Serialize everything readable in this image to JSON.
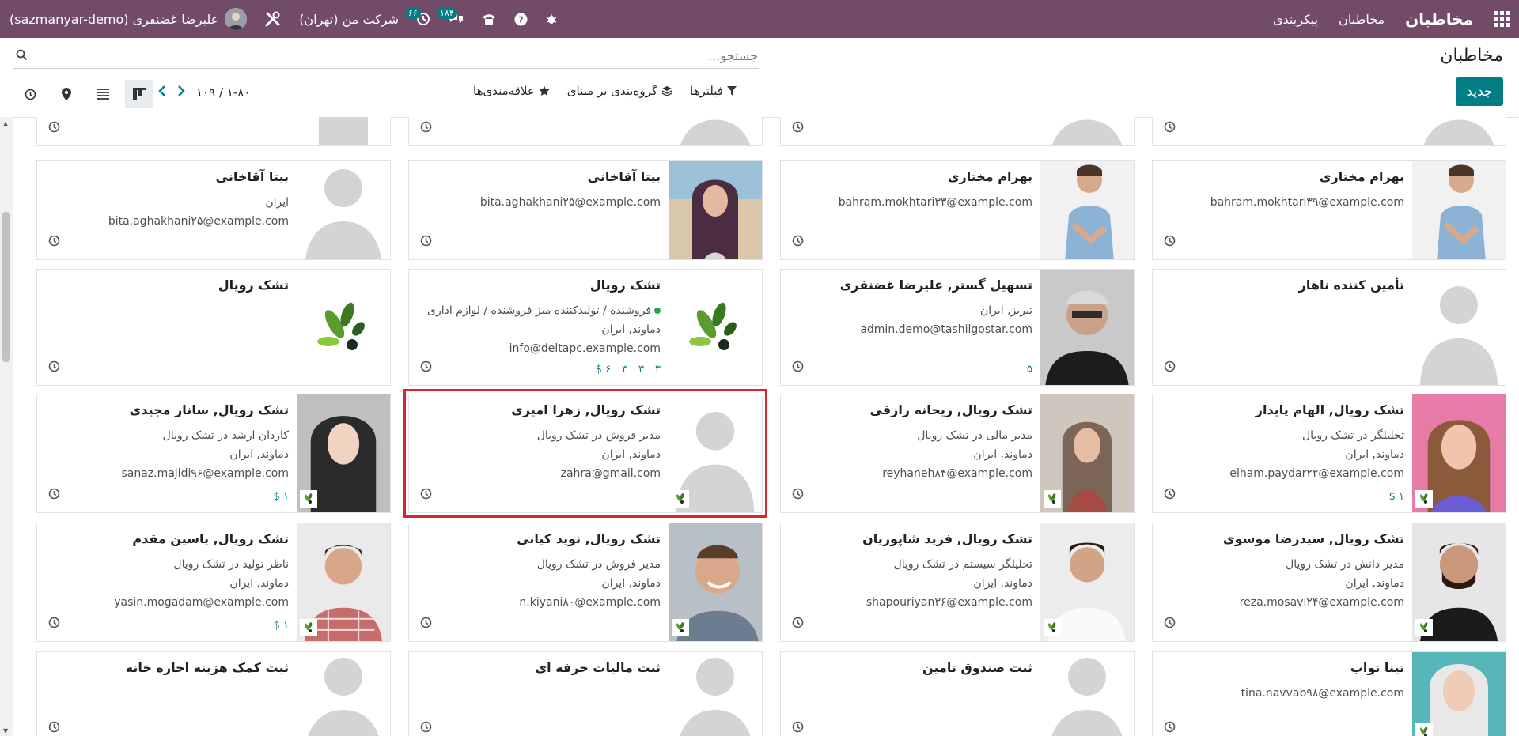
{
  "topbar": {
    "brand": "مخاطبان",
    "menu": [
      "مخاطبان",
      "پیکربندی"
    ],
    "company": "شرکت من (تهران)",
    "activity_badge": "۶۶",
    "chat_badge": "۱۸۴",
    "user": "علیرضا غضنفری (sazmanyar-demo)"
  },
  "control": {
    "title": "مخاطبان",
    "new_label": "جدید",
    "search_placeholder": "جستجو...",
    "filters_label": "فیلترها",
    "groupby_label": "گروه‌بندی بر مبنای",
    "favorites_label": "علاقه‌مندی‌ها",
    "pager_range": "۱-۸۰",
    "pager_total": "۱۰۹",
    "pager_sep": "/"
  },
  "colors": {
    "topbar": "#714b67",
    "accent": "#017e84",
    "selection": "#d9232d"
  },
  "cards": [
    {
      "name": "",
      "l1": "",
      "l2": "",
      "l3": "",
      "img": "placeholder",
      "stats": []
    },
    {
      "name": "",
      "l1": "",
      "l2": "",
      "l3": "",
      "img": "placeholder",
      "stats": []
    },
    {
      "name": "",
      "l1": "",
      "l2": "",
      "l3": "",
      "img": "placeholder",
      "stats": []
    },
    {
      "name": "",
      "l1": "",
      "l2": "",
      "l3": "",
      "img": "building",
      "stats": []
    },
    {
      "name": "بهرام مختاری",
      "l1": "bahram.mokhtari۳۹@example.com",
      "l2": "",
      "l3": "",
      "img": "man-blue",
      "stats": []
    },
    {
      "name": "بهرام مختاری",
      "l1": "bahram.mokhtari۳۳@example.com",
      "l2": "",
      "l3": "",
      "img": "man-blue",
      "stats": []
    },
    {
      "name": "بیتا آقاخانی",
      "l1": "bita.aghakhani۲۵@example.com",
      "l2": "",
      "l3": "",
      "img": "woman-scarf",
      "stats": []
    },
    {
      "name": "بیتا آقاخانی",
      "l1": "ایران",
      "l2": "bita.aghakhani۲۵@example.com",
      "l3": "",
      "img": "placeholder",
      "stats": []
    },
    {
      "name": "تأمین کننده ناهار",
      "l1": "",
      "l2": "",
      "l3": "",
      "img": "placeholder",
      "stats": []
    },
    {
      "name": "تسهیل گستر, علیرضا غضنفری",
      "l1": "تبریز, ایران",
      "l2": "admin.demo@tashilgostar.com",
      "l3": "",
      "img": "man-grey",
      "stats": [
        "۵"
      ]
    },
    {
      "name": "تشک رویال",
      "l1": "فروشنده / تولیدکننده میز  فروشنده / لوازم اداری",
      "l2": "دماوند, ایران",
      "l3": "info@deltapc.example.com",
      "img": "logo",
      "stats": [
        "۳",
        "۳",
        "۳",
        "۶ $"
      ]
    },
    {
      "name": "تشک رویال",
      "l1": "",
      "l2": "",
      "l3": "",
      "img": "logo",
      "stats": []
    },
    {
      "name": "تشک رویال, الهام پایدار",
      "l1": "تحلیلگر در تشک رویال",
      "l2": "دماوند, ایران",
      "l3": "elham.paydar۲۲@example.com",
      "img": "woman-pink",
      "stats": [
        "۱ $"
      ]
    },
    {
      "name": "تشک رویال, ریحانه رازقی",
      "l1": "مدیر مالی در تشک رویال",
      "l2": "دماوند, ایران",
      "l3": "reyhaneh۸۴@example.com",
      "img": "woman-scarf2",
      "stats": []
    },
    {
      "name": "تشک رویال, زهرا امیری",
      "l1": "مدیر فروش در تشک رویال",
      "l2": "دماوند, ایران",
      "l3": "zahra@gmail.com",
      "img": "placeholder",
      "stats": []
    },
    {
      "name": "تشک رویال, ساناز مجیدی",
      "l1": "کاردان ارشد در تشک رویال",
      "l2": "دماوند, ایران",
      "l3": "sanaz.majidi۹۶@example.com",
      "img": "woman-hijab",
      "stats": [
        "۱ $"
      ]
    },
    {
      "name": "تشک رویال, سیدرضا موسوی",
      "l1": "مدیر دانش در تشک رویال",
      "l2": "دماوند, ایران",
      "l3": "reza.mosavi۲۴@example.com",
      "img": "man-beard",
      "stats": []
    },
    {
      "name": "تشک رویال, فرید شاپوریان",
      "l1": "تحلیلگر سیستم در تشک رویال",
      "l2": "دماوند, ایران",
      "l3": "shapouriyan۳۶@example.com",
      "img": "man-white",
      "stats": []
    },
    {
      "name": "تشک رویال, نوید کیانی",
      "l1": "مدیر فروش در تشک رویال",
      "l2": "دماوند, ایران",
      "l3": "n.kiyani۸۰@example.com",
      "img": "man-smile",
      "stats": []
    },
    {
      "name": "تشک رویال, یاسین مقدم",
      "l1": "ناظر تولید در تشک رویال",
      "l2": "دماوند, ایران",
      "l3": "yasin.mogadam@example.com",
      "img": "man-plaid",
      "stats": [
        "۱ $"
      ]
    },
    {
      "name": "تینا نواب",
      "l1": "tina.navvab۹۸@example.com",
      "l2": "",
      "l3": "",
      "img": "woman-teal",
      "stats": []
    },
    {
      "name": "ثبت صندوق تامین",
      "l1": "",
      "l2": "",
      "l3": "",
      "img": "placeholder",
      "stats": []
    },
    {
      "name": "ثبت مالیات حرفه ای",
      "l1": "",
      "l2": "",
      "l3": "",
      "img": "placeholder",
      "stats": []
    },
    {
      "name": "ثبت کمک هزینه اجاره خانه",
      "l1": "",
      "l2": "",
      "l3": "",
      "img": "placeholder",
      "stats": []
    }
  ]
}
